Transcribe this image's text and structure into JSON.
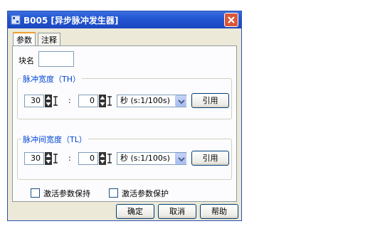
{
  "window": {
    "title": "B005 [异步脉冲发生器]"
  },
  "tabs": [
    {
      "label": "参数"
    },
    {
      "label": "注释"
    }
  ],
  "block_name": {
    "label": "块名",
    "value": ""
  },
  "pulse_width": {
    "legend": "脉冲宽度（TH）",
    "value": "30",
    "colon": ":",
    "second_value": "0",
    "unit": "秒 (s:1/100s)",
    "ref_button": "引用"
  },
  "pulse_interval": {
    "legend": "脉冲间宽度（TL）",
    "value": "30",
    "colon": ":",
    "second_value": "0",
    "unit": "秒 (s:1/100s)",
    "ref_button": "引用"
  },
  "options": {
    "retain": "激活参数保持",
    "protect": "激活参数保护"
  },
  "footer": {
    "ok": "确定",
    "cancel": "取消",
    "help": "帮助"
  }
}
